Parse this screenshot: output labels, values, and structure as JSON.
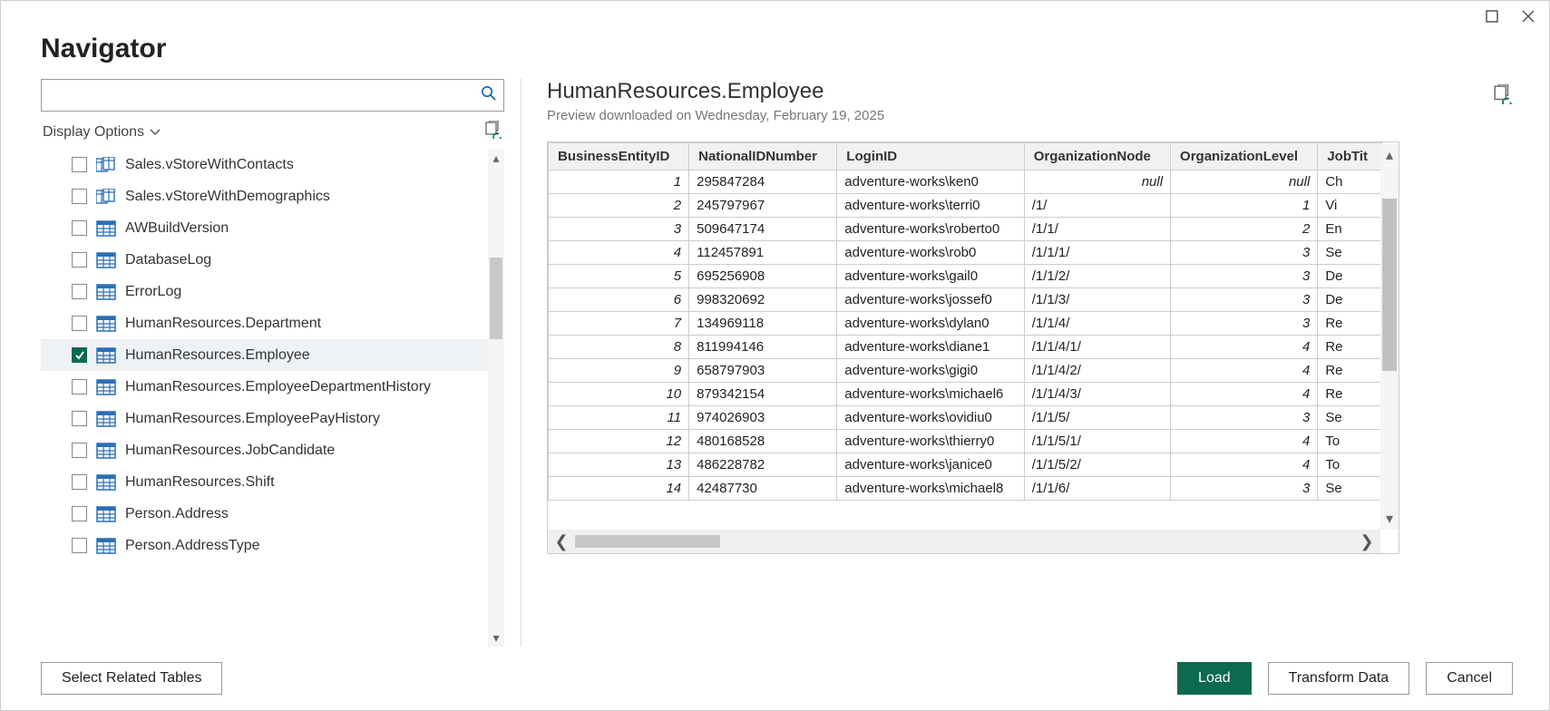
{
  "window": {
    "title": "Navigator"
  },
  "search": {
    "placeholder": ""
  },
  "displayOptions": {
    "label": "Display Options"
  },
  "tree": {
    "items": [
      {
        "label": "Sales.vStoreWithContacts",
        "type": "view",
        "checked": false
      },
      {
        "label": "Sales.vStoreWithDemographics",
        "type": "view",
        "checked": false
      },
      {
        "label": "AWBuildVersion",
        "type": "table",
        "checked": false
      },
      {
        "label": "DatabaseLog",
        "type": "table",
        "checked": false
      },
      {
        "label": "ErrorLog",
        "type": "table",
        "checked": false
      },
      {
        "label": "HumanResources.Department",
        "type": "table",
        "checked": false
      },
      {
        "label": "HumanResources.Employee",
        "type": "table",
        "checked": true
      },
      {
        "label": "HumanResources.EmployeeDepartmentHistory",
        "type": "table",
        "checked": false
      },
      {
        "label": "HumanResources.EmployeePayHistory",
        "type": "table",
        "checked": false
      },
      {
        "label": "HumanResources.JobCandidate",
        "type": "table",
        "checked": false
      },
      {
        "label": "HumanResources.Shift",
        "type": "table",
        "checked": false
      },
      {
        "label": "Person.Address",
        "type": "table",
        "checked": false
      },
      {
        "label": "Person.AddressType",
        "type": "table",
        "checked": false
      }
    ]
  },
  "preview": {
    "title": "HumanResources.Employee",
    "subtitle": "Preview downloaded on Wednesday, February 19, 2025",
    "columns": [
      "BusinessEntityID",
      "NationalIDNumber",
      "LoginID",
      "OrganizationNode",
      "OrganizationLevel",
      "JobTit"
    ],
    "rows": [
      {
        "id": "1",
        "nat": "295847284",
        "login": "adventure-works\\ken0",
        "node": "null",
        "lvl": "null",
        "jt": "Ch"
      },
      {
        "id": "2",
        "nat": "245797967",
        "login": "adventure-works\\terri0",
        "node": "/1/",
        "lvl": "1",
        "jt": "Vi"
      },
      {
        "id": "3",
        "nat": "509647174",
        "login": "adventure-works\\roberto0",
        "node": "/1/1/",
        "lvl": "2",
        "jt": "En"
      },
      {
        "id": "4",
        "nat": "112457891",
        "login": "adventure-works\\rob0",
        "node": "/1/1/1/",
        "lvl": "3",
        "jt": "Se"
      },
      {
        "id": "5",
        "nat": "695256908",
        "login": "adventure-works\\gail0",
        "node": "/1/1/2/",
        "lvl": "3",
        "jt": "De"
      },
      {
        "id": "6",
        "nat": "998320692",
        "login": "adventure-works\\jossef0",
        "node": "/1/1/3/",
        "lvl": "3",
        "jt": "De"
      },
      {
        "id": "7",
        "nat": "134969118",
        "login": "adventure-works\\dylan0",
        "node": "/1/1/4/",
        "lvl": "3",
        "jt": "Re"
      },
      {
        "id": "8",
        "nat": "811994146",
        "login": "adventure-works\\diane1",
        "node": "/1/1/4/1/",
        "lvl": "4",
        "jt": "Re"
      },
      {
        "id": "9",
        "nat": "658797903",
        "login": "adventure-works\\gigi0",
        "node": "/1/1/4/2/",
        "lvl": "4",
        "jt": "Re"
      },
      {
        "id": "10",
        "nat": "879342154",
        "login": "adventure-works\\michael6",
        "node": "/1/1/4/3/",
        "lvl": "4",
        "jt": "Re"
      },
      {
        "id": "11",
        "nat": "974026903",
        "login": "adventure-works\\ovidiu0",
        "node": "/1/1/5/",
        "lvl": "3",
        "jt": "Se"
      },
      {
        "id": "12",
        "nat": "480168528",
        "login": "adventure-works\\thierry0",
        "node": "/1/1/5/1/",
        "lvl": "4",
        "jt": "To"
      },
      {
        "id": "13",
        "nat": "486228782",
        "login": "adventure-works\\janice0",
        "node": "/1/1/5/2/",
        "lvl": "4",
        "jt": "To"
      },
      {
        "id": "14",
        "nat": "42487730",
        "login": "adventure-works\\michael8",
        "node": "/1/1/6/",
        "lvl": "3",
        "jt": "Se"
      }
    ]
  },
  "footer": {
    "selectRelated": "Select Related Tables",
    "load": "Load",
    "transform": "Transform Data",
    "cancel": "Cancel"
  }
}
